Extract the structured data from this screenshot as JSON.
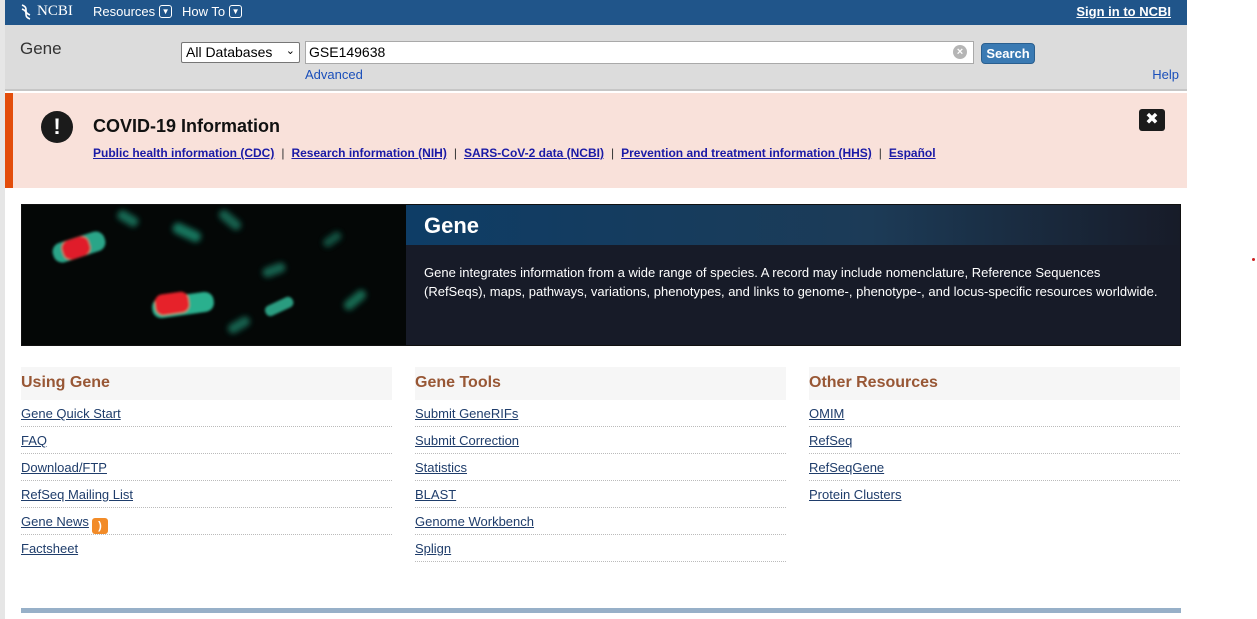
{
  "topbar": {
    "logo_text": "NCBI",
    "resources_label": "Resources",
    "howto_label": "How To",
    "signin_label": "Sign in to NCBI"
  },
  "search": {
    "db_name": "Gene",
    "db_select_value": "All Databases",
    "term_value": "GSE149638",
    "search_button": "Search",
    "advanced_link": "Advanced",
    "help_link": "Help"
  },
  "covid": {
    "title": "COVID-19 Information",
    "links": [
      "Public health information (CDC)",
      "Research information (NIH)",
      "SARS-CoV-2 data (NCBI)",
      "Prevention and treatment information (HHS)",
      "Español"
    ],
    "separator": "|",
    "accent_color": "#e34d0b",
    "background_color": "#f9e1da"
  },
  "hero": {
    "title": "Gene",
    "description": "Gene integrates information from a wide range of species. A record may include nomenclature, Reference Sequences (RefSeqs), maps, pathways, variations, phenotypes, and links to genome-, phenotype-, and locus-specific resources worldwide."
  },
  "columns": [
    {
      "heading": "Using Gene",
      "items": [
        "Gene Quick Start",
        "FAQ",
        "Download/FTP",
        "RefSeq Mailing List",
        "Gene News",
        "Factsheet"
      ]
    },
    {
      "heading": "Gene Tools",
      "items": [
        "Submit GeneRIFs",
        "Submit Correction",
        "Statistics",
        "BLAST",
        "Genome Workbench",
        "Splign"
      ]
    },
    {
      "heading": "Other Resources",
      "items": [
        "OMIM",
        "RefSeq",
        "RefSeqGene",
        "Protein Clusters"
      ]
    }
  ],
  "colors": {
    "topbar": "#20558a",
    "heading_text": "#985735",
    "link": "#1f3d6b"
  }
}
